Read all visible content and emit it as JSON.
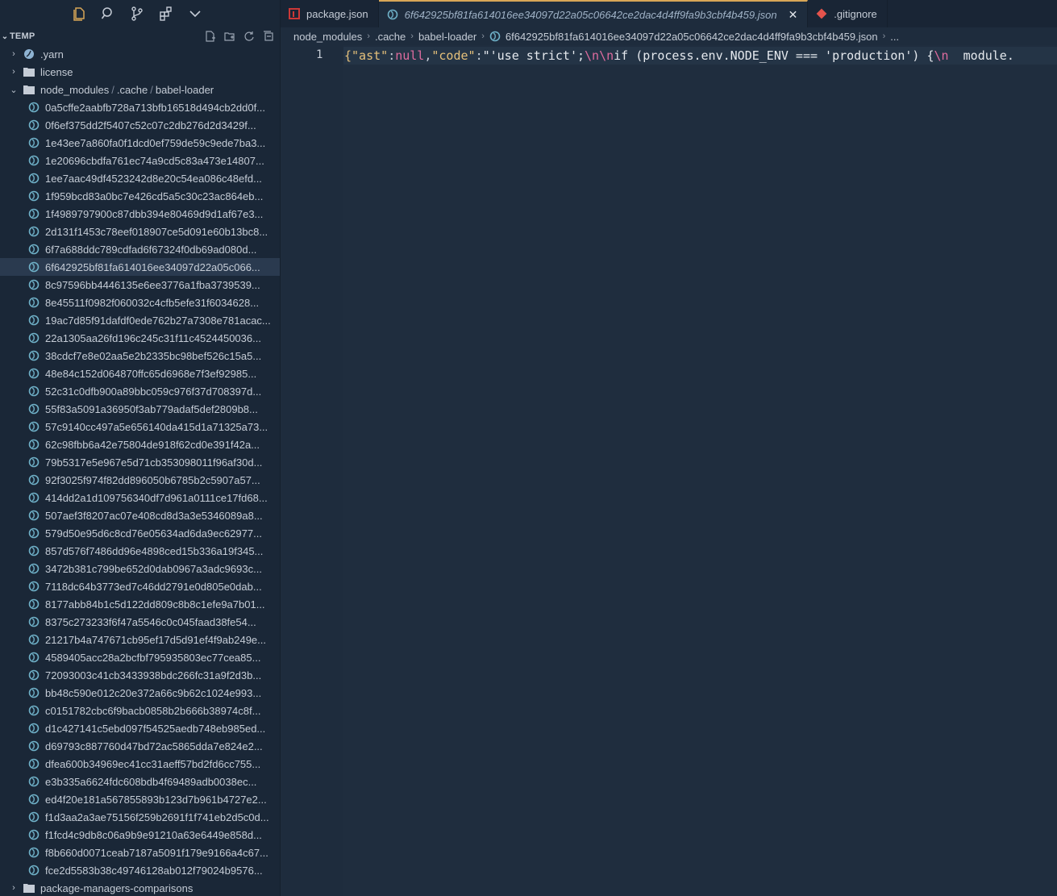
{
  "explorer": {
    "section_title": "TEMP",
    "folders": {
      "yarn": ".yarn",
      "license": "license",
      "node_modules": "node_modules",
      "cache": ".cache",
      "babel_loader": "babel-loader",
      "package_managers": "package-managers-comparisons"
    },
    "files": [
      "0a5cffe2aabfb728a713bfb16518d494cb2dd0f...",
      "0f6ef375dd2f5407c52c07c2db276d2d3429f...",
      "1e43ee7a860fa0f1dcd0ef759de59c9ede7ba3...",
      "1e20696cbdfa761ec74a9cd5c83a473e14807...",
      "1ee7aac49df4523242d8e20c54ea086c48efd...",
      "1f959bcd83a0bc7e426cd5a5c30c23ac864eb...",
      "1f4989797900c87dbb394e80469d9d1af67e3...",
      "2d131f1453c78eef018907ce5d091e60b13bc8...",
      "6f7a688ddc789cdfad6f67324f0db69ad080d...",
      "6f642925bf81fa614016ee34097d22a05c066...",
      "8c97596bb4446135e6ee3776a1fba3739539...",
      "8e45511f0982f060032c4cfb5efe31f6034628...",
      "19ac7d85f91dafdf0ede762b27a7308e781acac...",
      "22a1305aa26fd196c245c31f11c4524450036...",
      "38cdcf7e8e02aa5e2b2335bc98bef526c15a5...",
      "48e84c152d064870ffc65d6968e7f3ef92985...",
      "52c31c0dfb900a89bbc059c976f37d708397d...",
      "55f83a5091a36950f3ab779adaf5def2809b8...",
      "57c9140cc497a5e656140da415d1a71325a73...",
      "62c98fbb6a42e75804de918f62cd0e391f42a...",
      "79b5317e5e967e5d71cb353098011f96af30d...",
      "92f3025f974f82dd896050b6785b2c5907a57...",
      "414dd2a1d109756340df7d961a0111ce17fd68...",
      "507aef3f8207ac07e408cd8d3a3e5346089a8...",
      "579d50e95d6c8cd76e05634ad6da9ec62977...",
      "857d576f7486dd96e4898ced15b336a19f345...",
      "3472b381c799be652d0dab0967a3adc9693c...",
      "7118dc64b3773ed7c46dd2791e0d805e0dab...",
      "8177abb84b1c5d122dd809c8b8c1efe9a7b01...",
      "8375c273233f6f47a5546c0c045faad38fe54...",
      "21217b4a747671cb95ef17d5d91ef4f9ab249e...",
      "4589405acc28a2bcfbf795935803ec77cea85...",
      "72093003c41cb3433938bdc266fc31a9f2d3b...",
      "bb48c590e012c20e372a66c9b62c1024e993...",
      "c0151782cbc6f9bacb0858b2b666b38974c8f...",
      "d1c427141c5ebd097f54525aedb748eb985ed...",
      "d69793c887760d47bd72ac5865dda7e824e2...",
      "dfea600b34969ec41cc31aeff57bd2fd6cc755...",
      "e3b335a6624fdc608bdb4f69489adb0038ec...",
      "ed4f20e181a567855893b123d7b961b4727e2...",
      "f1d3aa2a3ae75156f259b2691f1f741eb2d5c0d...",
      "f1fcd4c9db8c06a9b9e91210a63e6449e858d...",
      "f8b660d0071ceab7187a5091f179e9166a4c67...",
      "fce2d5583b38c49746128ab012f79024b9576..."
    ],
    "selected_index": 9
  },
  "tabs": [
    {
      "label": "package.json",
      "icon": "npm-icon",
      "active": false
    },
    {
      "label": "6f642925bf81fa614016ee34097d22a05c06642ce2dac4d4ff9fa9b3cbf4b459.json",
      "icon": "babel-icon",
      "active": true
    },
    {
      "label": ".gitignore",
      "icon": "git-icon",
      "active": false
    }
  ],
  "breadcrumb": {
    "parts": [
      "node_modules",
      ".cache",
      "babel-loader",
      "6f642925bf81fa614016ee34097d22a05c06642ce2dac4d4ff9fa9b3cbf4b459.json",
      "..."
    ]
  },
  "editor": {
    "line_number": "1",
    "tokens": [
      {
        "t": "{",
        "c": "c-brace"
      },
      {
        "t": "\"ast\"",
        "c": "c-key"
      },
      {
        "t": ":",
        "c": "c-punc"
      },
      {
        "t": "null",
        "c": "c-kw"
      },
      {
        "t": ",",
        "c": "c-punc"
      },
      {
        "t": "\"code\"",
        "c": "c-key"
      },
      {
        "t": ":",
        "c": "c-punc"
      },
      {
        "t": "\"'use strict';",
        "c": "c-str"
      },
      {
        "t": "\\n\\n",
        "c": "c-esc"
      },
      {
        "t": "if (process.env.NODE_ENV === 'production') {",
        "c": "c-str"
      },
      {
        "t": "\\n",
        "c": "c-esc"
      },
      {
        "t": "  module.",
        "c": "c-str"
      }
    ]
  },
  "colors": {
    "accent_tab_border": "#d8a657",
    "babel_icon": "#6fb1c8",
    "npm_icon": "#cb3837",
    "git_icon": "#e4534c"
  }
}
